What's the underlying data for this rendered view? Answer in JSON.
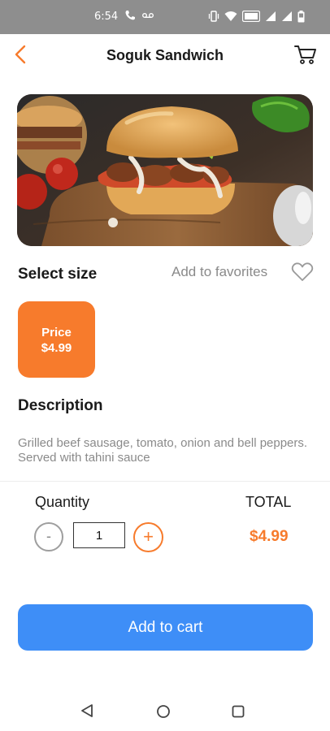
{
  "status_bar": {
    "time": "6:54",
    "icons": [
      "phone-icon",
      "voicemail-icon",
      "vibrate-icon",
      "wifi-icon",
      "volte-icon",
      "signal-icon",
      "signal-icon",
      "battery-icon"
    ],
    "color": "#8e8e8e"
  },
  "header": {
    "title": "Soguk Sandwich",
    "back_icon": "chevron-left-icon",
    "cart_icon": "cart-icon",
    "accent": "#f77b2c"
  },
  "product": {
    "image": "sandwich-photo"
  },
  "size_section": {
    "title": "Select size",
    "favorites_label": "Add to favorites",
    "favorites_icon": "heart-icon",
    "sizes": [
      {
        "label": "Price",
        "price": "$4.99",
        "selected": true
      }
    ]
  },
  "description": {
    "title": "Description",
    "text": "Grilled beef sausage, tomato, onion and bell peppers. Served with tahini sauce"
  },
  "order": {
    "quantity_label": "Quantity",
    "minus_label": "-",
    "quantity_value": "1",
    "plus_label": "+",
    "total_label": "TOTAL",
    "total_value": "$4.99"
  },
  "actions": {
    "add_to_cart_label": "Add to cart",
    "button_color": "#3e8ef7"
  },
  "nav_bar": {
    "icons": [
      "nav-back-icon",
      "nav-home-icon",
      "nav-recents-icon"
    ]
  }
}
